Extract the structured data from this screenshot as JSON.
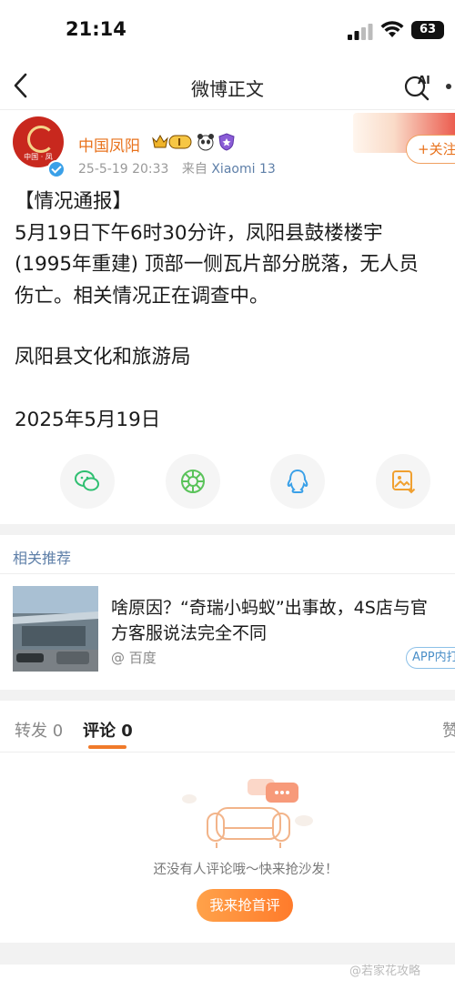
{
  "status_bar": {
    "time": "21:14",
    "battery": "63"
  },
  "nav": {
    "title": "微博正文",
    "ai_label": "AI"
  },
  "post": {
    "author": "中国凤阳",
    "avatar_text": "中国 · 凤",
    "level": "I",
    "time": "25-5-19 20:33",
    "source_prefix": "来自",
    "device": "Xiaomi 13",
    "follow_label": "+关注",
    "lines": [
      "【情况通报】",
      "5月19日下午6时30分许，凤阳县鼓楼楼宇",
      "(1995年重建) 顶部一侧瓦片部分脱落，无人员",
      "伤亡。相关情况正在调查中。"
    ],
    "signature": "凤阳县文化和旅游局",
    "date": "2025年5月19日"
  },
  "share_icons": [
    "wechat-icon",
    "moments-icon",
    "qq-icon",
    "save-image-icon"
  ],
  "recommend": {
    "title": "相关推荐",
    "headline_line1": "啥原因？“奇瑞小蚂蚁”出事故，4S店与官",
    "headline_line2": "方客服说法完全不同",
    "source": "@ 百度",
    "app_label": "APP内打开"
  },
  "tabs": {
    "repost": "转发 0",
    "comment": "评论 0",
    "like": "赞"
  },
  "empty": {
    "message": "还没有人评论哦～快来抢沙发！",
    "button": "我来抢首评"
  },
  "watermark": "@若家花攻略"
}
